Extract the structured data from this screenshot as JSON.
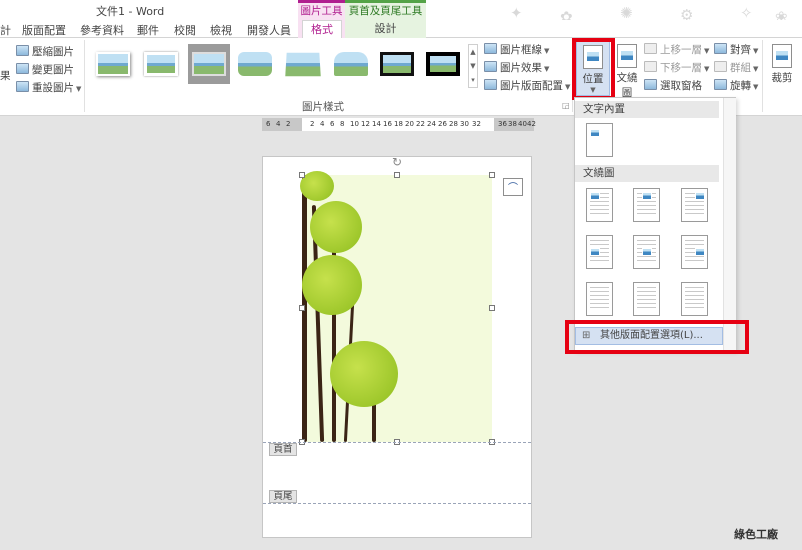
{
  "window": {
    "title": "文件1 - Word"
  },
  "contextual_groups": {
    "picture_tools": "圖片工具",
    "header_footer_tools": "頁首及頁尾工具"
  },
  "tabs": [
    {
      "label": "計"
    },
    {
      "label": "版面配置"
    },
    {
      "label": "參考資料"
    },
    {
      "label": "郵件"
    },
    {
      "label": "校閱"
    },
    {
      "label": "檢視"
    },
    {
      "label": "開發人員"
    },
    {
      "label": "格式"
    },
    {
      "label": "設計"
    }
  ],
  "ribbon": {
    "adjust": {
      "left_partial": "果",
      "compress": "壓縮圖片",
      "change": "變更圖片",
      "reset": "重設圖片"
    },
    "picture_styles": {
      "label": "圖片樣式",
      "border": "圖片框線",
      "effects": "圖片效果",
      "layout": "圖片版面配置"
    },
    "arrange": {
      "position": "位置",
      "wrap_text": "文繞圖",
      "bring_forward": "上移一層",
      "send_backward": "下移一層",
      "selection_pane": "選取窗格",
      "align": "對齊",
      "group": "群組",
      "rotate": "旋轉"
    },
    "size": {
      "crop": "裁剪"
    }
  },
  "ruler": {
    "ticks": [
      "6",
      "4",
      "2",
      "2",
      "4",
      "6",
      "8",
      "10",
      "12",
      "14",
      "16",
      "18",
      "20",
      "22",
      "24",
      "26",
      "28",
      "30",
      "32",
      "36",
      "38",
      "40",
      "42"
    ]
  },
  "document": {
    "header_tag": "頁首",
    "footer_tag": "頁尾"
  },
  "position_menu": {
    "inline_header": "文字內置",
    "wrap_header": "文繞圖",
    "more_options": "其他版面配置選項(L)..."
  },
  "watermark": "綠色工廠",
  "colors": {
    "accent_picture_tools": "#b01e8f",
    "accent_header_footer": "#54a347",
    "highlight_red": "#e60012"
  }
}
